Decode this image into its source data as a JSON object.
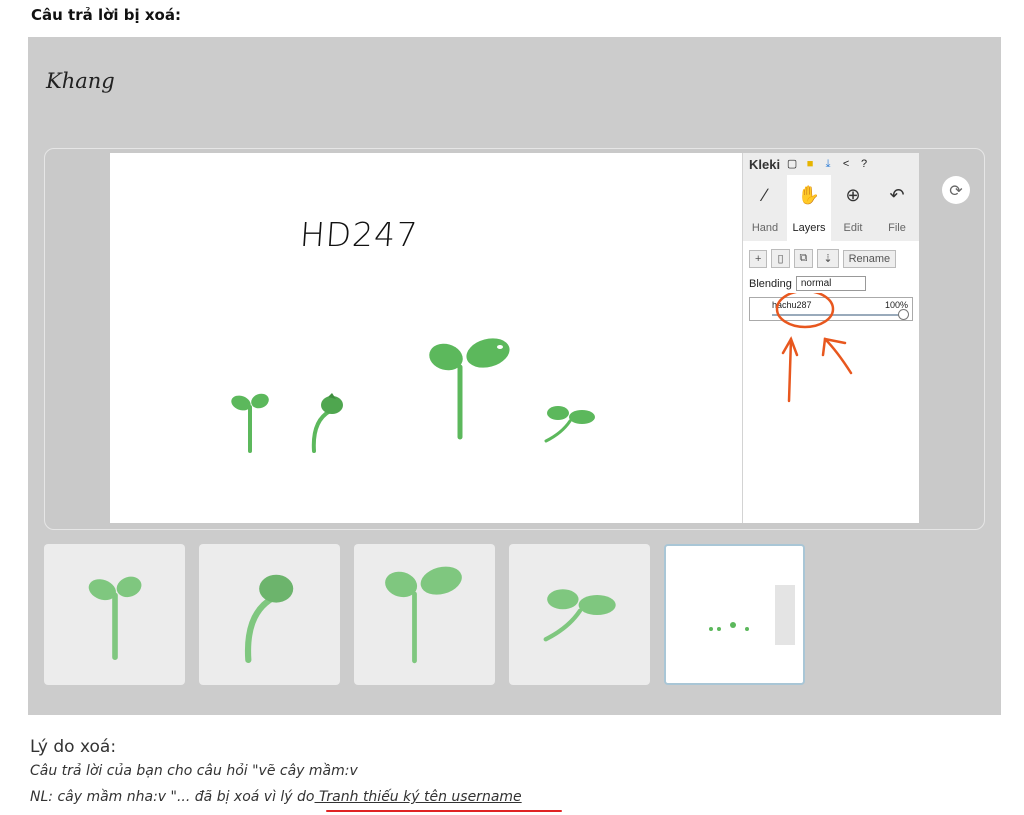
{
  "header": {
    "title": "Câu trả lời bị xoá:"
  },
  "answer": {
    "author": "Khang",
    "drawing_text": "HD247"
  },
  "kleki": {
    "logo": "Kleki",
    "tabs": [
      "Hand",
      "Layers",
      "Edit",
      "File"
    ],
    "active_tab": "Layers",
    "rename_label": "Rename",
    "blending_label": "Blending",
    "blending_value": "normal",
    "layer_name": "hachu287",
    "layer_opacity": "100%"
  },
  "thumbnails": {
    "count": 5,
    "selected_index": 4
  },
  "reason": {
    "label": "Lý do xoá:",
    "line1": "Câu trả lời của bạn cho câu hỏi \"vẽ cây mầm:v",
    "line2_prefix": "NL: cây mầm nha:v \"... đã bị xoá vì lý do",
    "line2_reason": " Tranh thiếu ký tên username"
  },
  "colors": {
    "sprout": "#5cb85c",
    "sprout_dark": "#3e8e3e",
    "annotation": "#e8571e",
    "panel": "#cccccc"
  }
}
